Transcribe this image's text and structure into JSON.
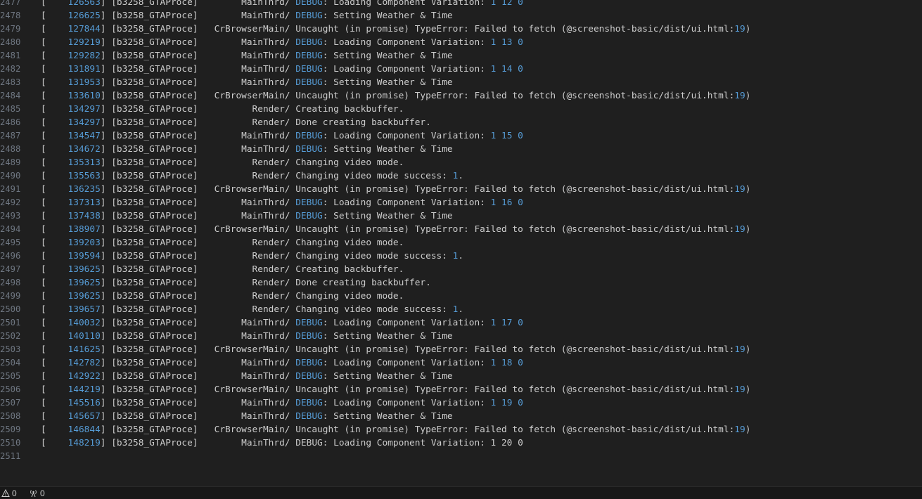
{
  "editor": {
    "lines": [
      {
        "ln": "2477",
        "ts": "126563",
        "proc": "b3258_GTAProce",
        "kind": "variation",
        "tag": "MainThrd/",
        "debug": "DEBUG",
        "text": ": Loading Component Variation: ",
        "nums": "1 12 0"
      },
      {
        "ln": "2478",
        "ts": "126625",
        "proc": "b3258_GTAProce",
        "kind": "debug",
        "tag": "MainThrd/",
        "debug": "DEBUG",
        "text": ": Setting Weather & Time"
      },
      {
        "ln": "2479",
        "ts": "127844",
        "proc": "b3258_GTAProce",
        "kind": "error",
        "tag": "CrBrowserMain/",
        "text": "Uncaught (in promise) TypeError: Failed to fetch (@screenshot-basic/dist/ui.html:",
        "num": "19",
        "tail": ")"
      },
      {
        "ln": "2480",
        "ts": "129219",
        "proc": "b3258_GTAProce",
        "kind": "variation",
        "tag": "MainThrd/",
        "debug": "DEBUG",
        "text": ": Loading Component Variation: ",
        "nums": "1 13 0"
      },
      {
        "ln": "2481",
        "ts": "129282",
        "proc": "b3258_GTAProce",
        "kind": "debug",
        "tag": "MainThrd/",
        "debug": "DEBUG",
        "text": ": Setting Weather & Time"
      },
      {
        "ln": "2482",
        "ts": "131891",
        "proc": "b3258_GTAProce",
        "kind": "variation",
        "tag": "MainThrd/",
        "debug": "DEBUG",
        "text": ": Loading Component Variation: ",
        "nums": "1 14 0"
      },
      {
        "ln": "2483",
        "ts": "131953",
        "proc": "b3258_GTAProce",
        "kind": "debug",
        "tag": "MainThrd/",
        "debug": "DEBUG",
        "text": ": Setting Weather & Time"
      },
      {
        "ln": "2484",
        "ts": "133610",
        "proc": "b3258_GTAProce",
        "kind": "error",
        "tag": "CrBrowserMain/",
        "text": "Uncaught (in promise) TypeError: Failed to fetch (@screenshot-basic/dist/ui.html:",
        "num": "19",
        "tail": ")"
      },
      {
        "ln": "2485",
        "ts": "134297",
        "proc": "b3258_GTAProce",
        "kind": "render",
        "tag": "Render/",
        "text": "Creating backbuffer."
      },
      {
        "ln": "2486",
        "ts": "134297",
        "proc": "b3258_GTAProce",
        "kind": "render",
        "tag": "Render/",
        "text": "Done creating backbuffer."
      },
      {
        "ln": "2487",
        "ts": "134547",
        "proc": "b3258_GTAProce",
        "kind": "variation",
        "tag": "MainThrd/",
        "debug": "DEBUG",
        "text": ": Loading Component Variation: ",
        "nums": "1 15 0"
      },
      {
        "ln": "2488",
        "ts": "134672",
        "proc": "b3258_GTAProce",
        "kind": "debug",
        "tag": "MainThrd/",
        "debug": "DEBUG",
        "text": ": Setting Weather & Time"
      },
      {
        "ln": "2489",
        "ts": "135313",
        "proc": "b3258_GTAProce",
        "kind": "render",
        "tag": "Render/",
        "text": "Changing video mode."
      },
      {
        "ln": "2490",
        "ts": "135563",
        "proc": "b3258_GTAProce",
        "kind": "render",
        "tag": "Render/",
        "text": "Changing video mode success: ",
        "num": "1",
        "tail": "."
      },
      {
        "ln": "2491",
        "ts": "136235",
        "proc": "b3258_GTAProce",
        "kind": "error",
        "tag": "CrBrowserMain/",
        "text": "Uncaught (in promise) TypeError: Failed to fetch (@screenshot-basic/dist/ui.html:",
        "num": "19",
        "tail": ")"
      },
      {
        "ln": "2492",
        "ts": "137313",
        "proc": "b3258_GTAProce",
        "kind": "variation",
        "tag": "MainThrd/",
        "debug": "DEBUG",
        "text": ": Loading Component Variation: ",
        "nums": "1 16 0"
      },
      {
        "ln": "2493",
        "ts": "137438",
        "proc": "b3258_GTAProce",
        "kind": "debug",
        "tag": "MainThrd/",
        "debug": "DEBUG",
        "text": ": Setting Weather & Time"
      },
      {
        "ln": "2494",
        "ts": "138907",
        "proc": "b3258_GTAProce",
        "kind": "error",
        "tag": "CrBrowserMain/",
        "text": "Uncaught (in promise) TypeError: Failed to fetch (@screenshot-basic/dist/ui.html:",
        "num": "19",
        "tail": ")"
      },
      {
        "ln": "2495",
        "ts": "139203",
        "proc": "b3258_GTAProce",
        "kind": "render",
        "tag": "Render/",
        "text": "Changing video mode."
      },
      {
        "ln": "2496",
        "ts": "139594",
        "proc": "b3258_GTAProce",
        "kind": "render",
        "tag": "Render/",
        "text": "Changing video mode success: ",
        "num": "1",
        "tail": "."
      },
      {
        "ln": "2497",
        "ts": "139625",
        "proc": "b3258_GTAProce",
        "kind": "render",
        "tag": "Render/",
        "text": "Creating backbuffer."
      },
      {
        "ln": "2498",
        "ts": "139625",
        "proc": "b3258_GTAProce",
        "kind": "render",
        "tag": "Render/",
        "text": "Done creating backbuffer."
      },
      {
        "ln": "2499",
        "ts": "139625",
        "proc": "b3258_GTAProce",
        "kind": "render",
        "tag": "Render/",
        "text": "Changing video mode."
      },
      {
        "ln": "2500",
        "ts": "139657",
        "proc": "b3258_GTAProce",
        "kind": "render",
        "tag": "Render/",
        "text": "Changing video mode success: ",
        "num": "1",
        "tail": "."
      },
      {
        "ln": "2501",
        "ts": "140032",
        "proc": "b3258_GTAProce",
        "kind": "variation",
        "tag": "MainThrd/",
        "debug": "DEBUG",
        "text": ": Loading Component Variation: ",
        "nums": "1 17 0"
      },
      {
        "ln": "2502",
        "ts": "140110",
        "proc": "b3258_GTAProce",
        "kind": "debug",
        "tag": "MainThrd/",
        "debug": "DEBUG",
        "text": ": Setting Weather & Time"
      },
      {
        "ln": "2503",
        "ts": "141625",
        "proc": "b3258_GTAProce",
        "kind": "error",
        "tag": "CrBrowserMain/",
        "text": "Uncaught (in promise) TypeError: Failed to fetch (@screenshot-basic/dist/ui.html:",
        "num": "19",
        "tail": ")"
      },
      {
        "ln": "2504",
        "ts": "142782",
        "proc": "b3258_GTAProce",
        "kind": "variation",
        "tag": "MainThrd/",
        "debug": "DEBUG",
        "text": ": Loading Component Variation: ",
        "nums": "1 18 0"
      },
      {
        "ln": "2505",
        "ts": "142922",
        "proc": "b3258_GTAProce",
        "kind": "debug",
        "tag": "MainThrd/",
        "debug": "DEBUG",
        "text": ": Setting Weather & Time"
      },
      {
        "ln": "2506",
        "ts": "144219",
        "proc": "b3258_GTAProce",
        "kind": "error",
        "tag": "CrBrowserMain/",
        "text": "Uncaught (in promise) TypeError: Failed to fetch (@screenshot-basic/dist/ui.html:",
        "num": "19",
        "tail": ")"
      },
      {
        "ln": "2507",
        "ts": "145516",
        "proc": "b3258_GTAProce",
        "kind": "variation",
        "tag": "MainThrd/",
        "debug": "DEBUG",
        "text": ": Loading Component Variation: ",
        "nums": "1 19 0"
      },
      {
        "ln": "2508",
        "ts": "145657",
        "proc": "b3258_GTAProce",
        "kind": "debug",
        "tag": "MainThrd/",
        "debug": "DEBUG",
        "text": ": Setting Weather & Time"
      },
      {
        "ln": "2509",
        "ts": "146844",
        "proc": "b3258_GTAProce",
        "kind": "error",
        "tag": "CrBrowserMain/",
        "text": "Uncaught (in promise) TypeError: Failed to fetch (@screenshot-basic/dist/ui.html:",
        "num": "19",
        "tail": ")"
      },
      {
        "ln": "2510",
        "ts": "148219",
        "proc": "b3258_GTAProce",
        "kind": "plain",
        "tag": "MainThrd/",
        "text": "DEBUG: Loading Component Variation: 1 20 0"
      },
      {
        "ln": "2511",
        "kind": "empty"
      }
    ]
  },
  "statusbar": {
    "problems_icon": "warning-icon",
    "problems_count": "0",
    "ports_icon": "broadcast-icon",
    "ports_count": "0"
  },
  "colors": {
    "background": "#1f1f1f",
    "text": "#cccccc",
    "number": "#569cd6",
    "line_number": "#6e7681"
  }
}
